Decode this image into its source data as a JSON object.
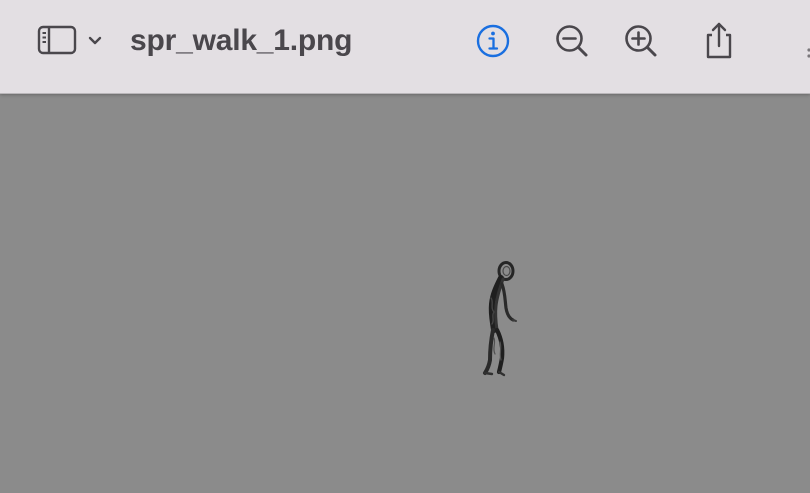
{
  "window": {
    "title": "spr_walk_1.png"
  },
  "toolbar": {
    "sidebar_toggle_icon": "sidebar-icon",
    "sidebar_menu_icon": "chevron-down-icon",
    "info_icon": "info-circle-icon",
    "zoom_out_icon": "zoom-out-icon",
    "zoom_in_icon": "zoom-in-icon",
    "share_icon": "share-icon",
    "accent_color": "#1a6fe0",
    "icon_color": "#4a474c"
  },
  "canvas": {
    "background_color": "#8b8b8b",
    "image": "walking-figure-sprite"
  }
}
